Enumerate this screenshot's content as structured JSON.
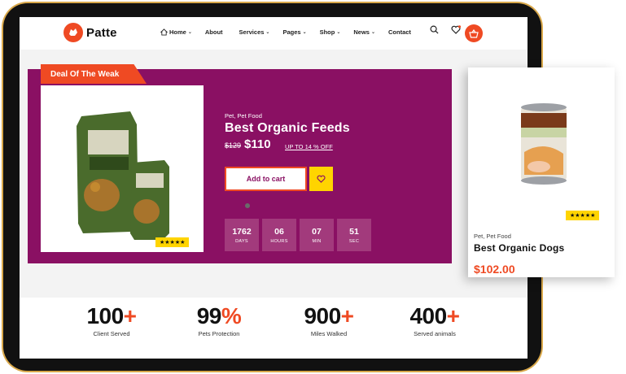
{
  "brand": {
    "name": "Patte"
  },
  "nav": {
    "items": [
      {
        "label": "Home",
        "dropdown": true
      },
      {
        "label": "About",
        "dropdown": false
      },
      {
        "label": "Services",
        "dropdown": true
      },
      {
        "label": "Pages",
        "dropdown": true
      },
      {
        "label": "Shop",
        "dropdown": true
      },
      {
        "label": "News",
        "dropdown": true
      },
      {
        "label": "Contact",
        "dropdown": false
      }
    ]
  },
  "colors": {
    "accent": "#ef4a23",
    "banner": "#8a1063",
    "rating": "#ffd400"
  },
  "deal": {
    "tag": "Deal Of The Weak",
    "category": "Pet, Pet Food",
    "title": "Best Organic Feeds",
    "old_price": "$129",
    "price": "$110",
    "discount": "UP TO 14 % OFF",
    "add_to_cart": "Add to cart",
    "stars": "★★★★★",
    "countdown": [
      {
        "value": "1762",
        "label": "DAYS"
      },
      {
        "value": "06",
        "label": "HOURS"
      },
      {
        "value": "07",
        "label": "MIN"
      },
      {
        "value": "51",
        "label": "SEC"
      }
    ]
  },
  "stats": [
    {
      "number": "100",
      "suffix": "+",
      "label": "Client Served"
    },
    {
      "number": "99",
      "suffix": "%",
      "label": "Pets Protection"
    },
    {
      "number": "900",
      "suffix": "+",
      "label": "Miles Walked"
    },
    {
      "number": "400",
      "suffix": "+",
      "label": "Served animals"
    }
  ],
  "side_product": {
    "category": "Pet, Pet Food",
    "title": "Best Organic Dogs",
    "price": "$102.00",
    "stars": "★★★★★"
  }
}
